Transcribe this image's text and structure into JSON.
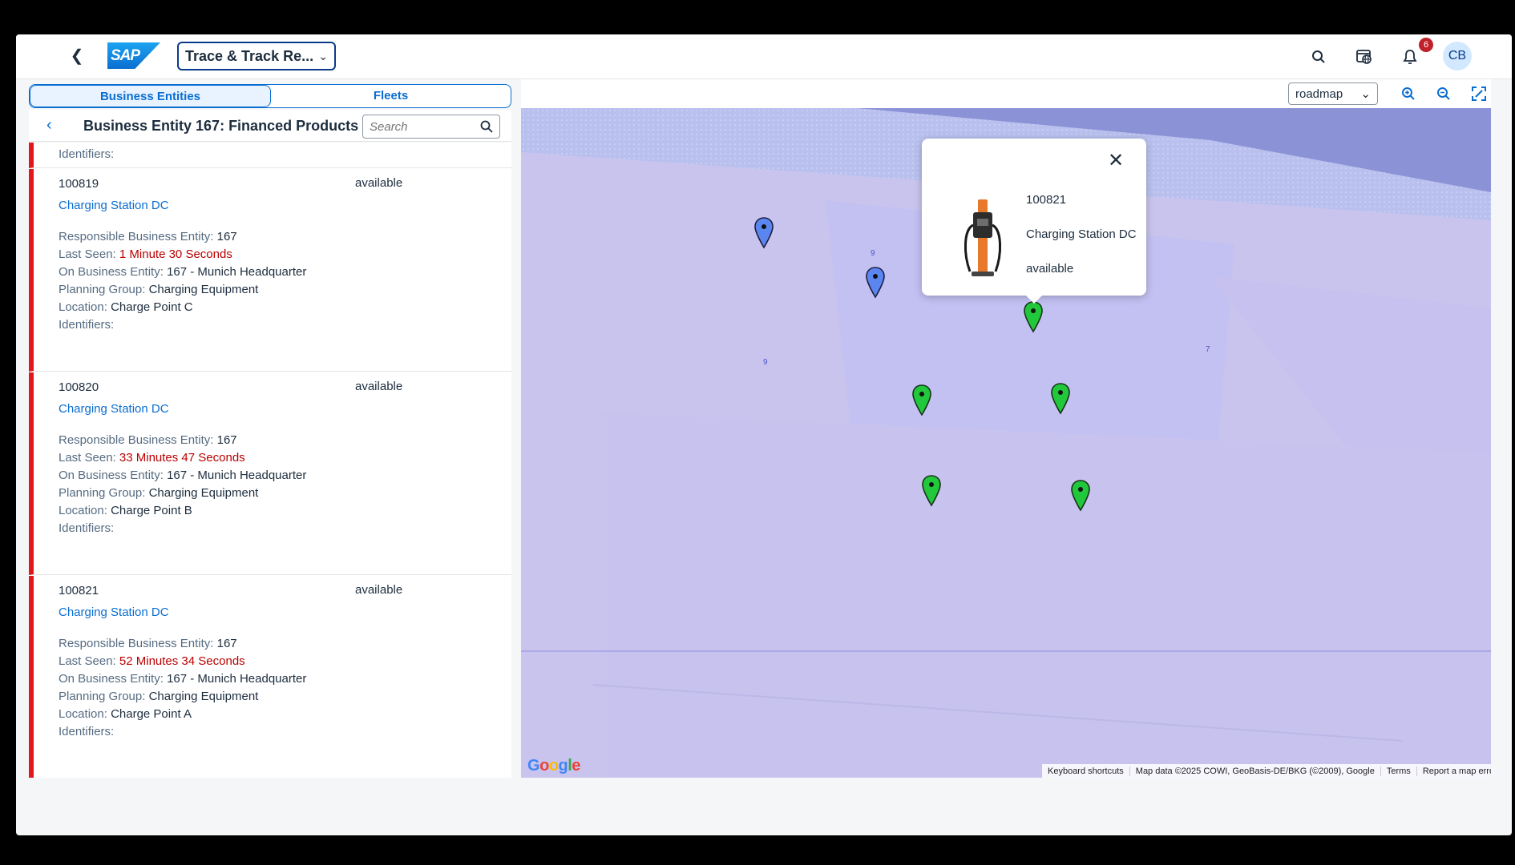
{
  "shell": {
    "app_title": "Trace & Track Re...",
    "notification_count": "6",
    "avatar_initials": "CB",
    "logo_text": "SAP"
  },
  "segmented": {
    "tab1": "Business Entities",
    "tab2": "Fleets"
  },
  "list_header": {
    "title": "Business Entity 167: Financed Products",
    "search_placeholder": "Search"
  },
  "labels": {
    "responsible": "Responsible Business Entity:",
    "last_seen": "Last Seen:",
    "on_entity": "On Business Entity:",
    "planning": "Planning Group:",
    "location": "Location:",
    "identifiers": "Identifiers:"
  },
  "items": [
    {
      "id": "100819",
      "status": "available",
      "name": "Charging Station DC",
      "responsible": "167",
      "last_seen": "1 Minute 30 Seconds",
      "on_entity": "167 - Munich Headquarter",
      "planning": "Charging Equipment",
      "location": "Charge Point C"
    },
    {
      "id": "100820",
      "status": "available",
      "name": "Charging Station DC",
      "responsible": "167",
      "last_seen": "33 Minutes 47 Seconds",
      "on_entity": "167 - Munich Headquarter",
      "planning": "Charging Equipment",
      "location": "Charge Point B"
    },
    {
      "id": "100821",
      "status": "available",
      "name": "Charging Station DC",
      "responsible": "167",
      "last_seen": "52 Minutes 34 Seconds",
      "on_entity": "167 - Munich Headquarter",
      "planning": "Charging Equipment",
      "location": "Charge Point A"
    }
  ],
  "map": {
    "map_type": "roadmap",
    "popup": {
      "id": "100821",
      "name": "Charging Station DC",
      "status": "available"
    },
    "street_labels": [
      "9",
      "9",
      "7"
    ],
    "footer": {
      "shortcuts": "Keyboard shortcuts",
      "data": "Map data ©2025 COWI, GeoBasis-DE/BKG (©2009), Google",
      "terms": "Terms",
      "report": "Report a map error"
    },
    "google_logo": "Google",
    "marker_colors": {
      "blue": "#5b86f0",
      "green": "#22c83c"
    }
  }
}
